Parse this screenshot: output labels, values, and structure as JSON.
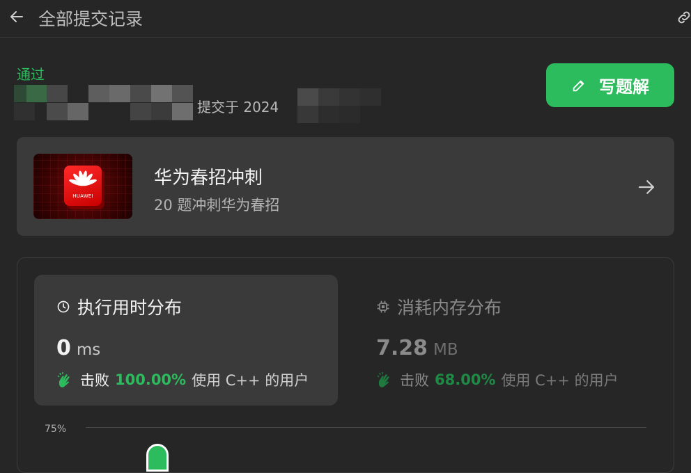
{
  "header": {
    "title": "全部提交记录"
  },
  "submission": {
    "status": "通过",
    "submitted_text": "提交于 2024",
    "write_solution_label": "写题解"
  },
  "study_plan": {
    "title": "华为春招冲刺",
    "subtitle": "20 题冲刺华为春招",
    "logo_text": "HUAWEI"
  },
  "runtime": {
    "title": "执行用时分布",
    "value": "0",
    "unit": "ms",
    "beat_label": "击败",
    "beat_percent": "100.00%",
    "beat_suffix": "使用 C++ 的用户"
  },
  "memory": {
    "title": "消耗内存分布",
    "value": "7.28",
    "unit": "MB",
    "beat_label": "击败",
    "beat_percent": "68.00%",
    "beat_suffix": "使用 C++ 的用户"
  },
  "chart": {
    "y_tick": "75%"
  },
  "colors": {
    "accent": "#2cbb5d",
    "background": "#262626",
    "card": "#3a3a3a",
    "muted_text": "#8a8a8a"
  },
  "icons": {
    "back": "arrow-left-icon",
    "link": "link-icon",
    "edit": "edit-icon",
    "card_arrow": "arrow-right-icon",
    "runtime": "clock-icon",
    "memory": "chip-icon",
    "beat": "clap-hands-icon"
  }
}
